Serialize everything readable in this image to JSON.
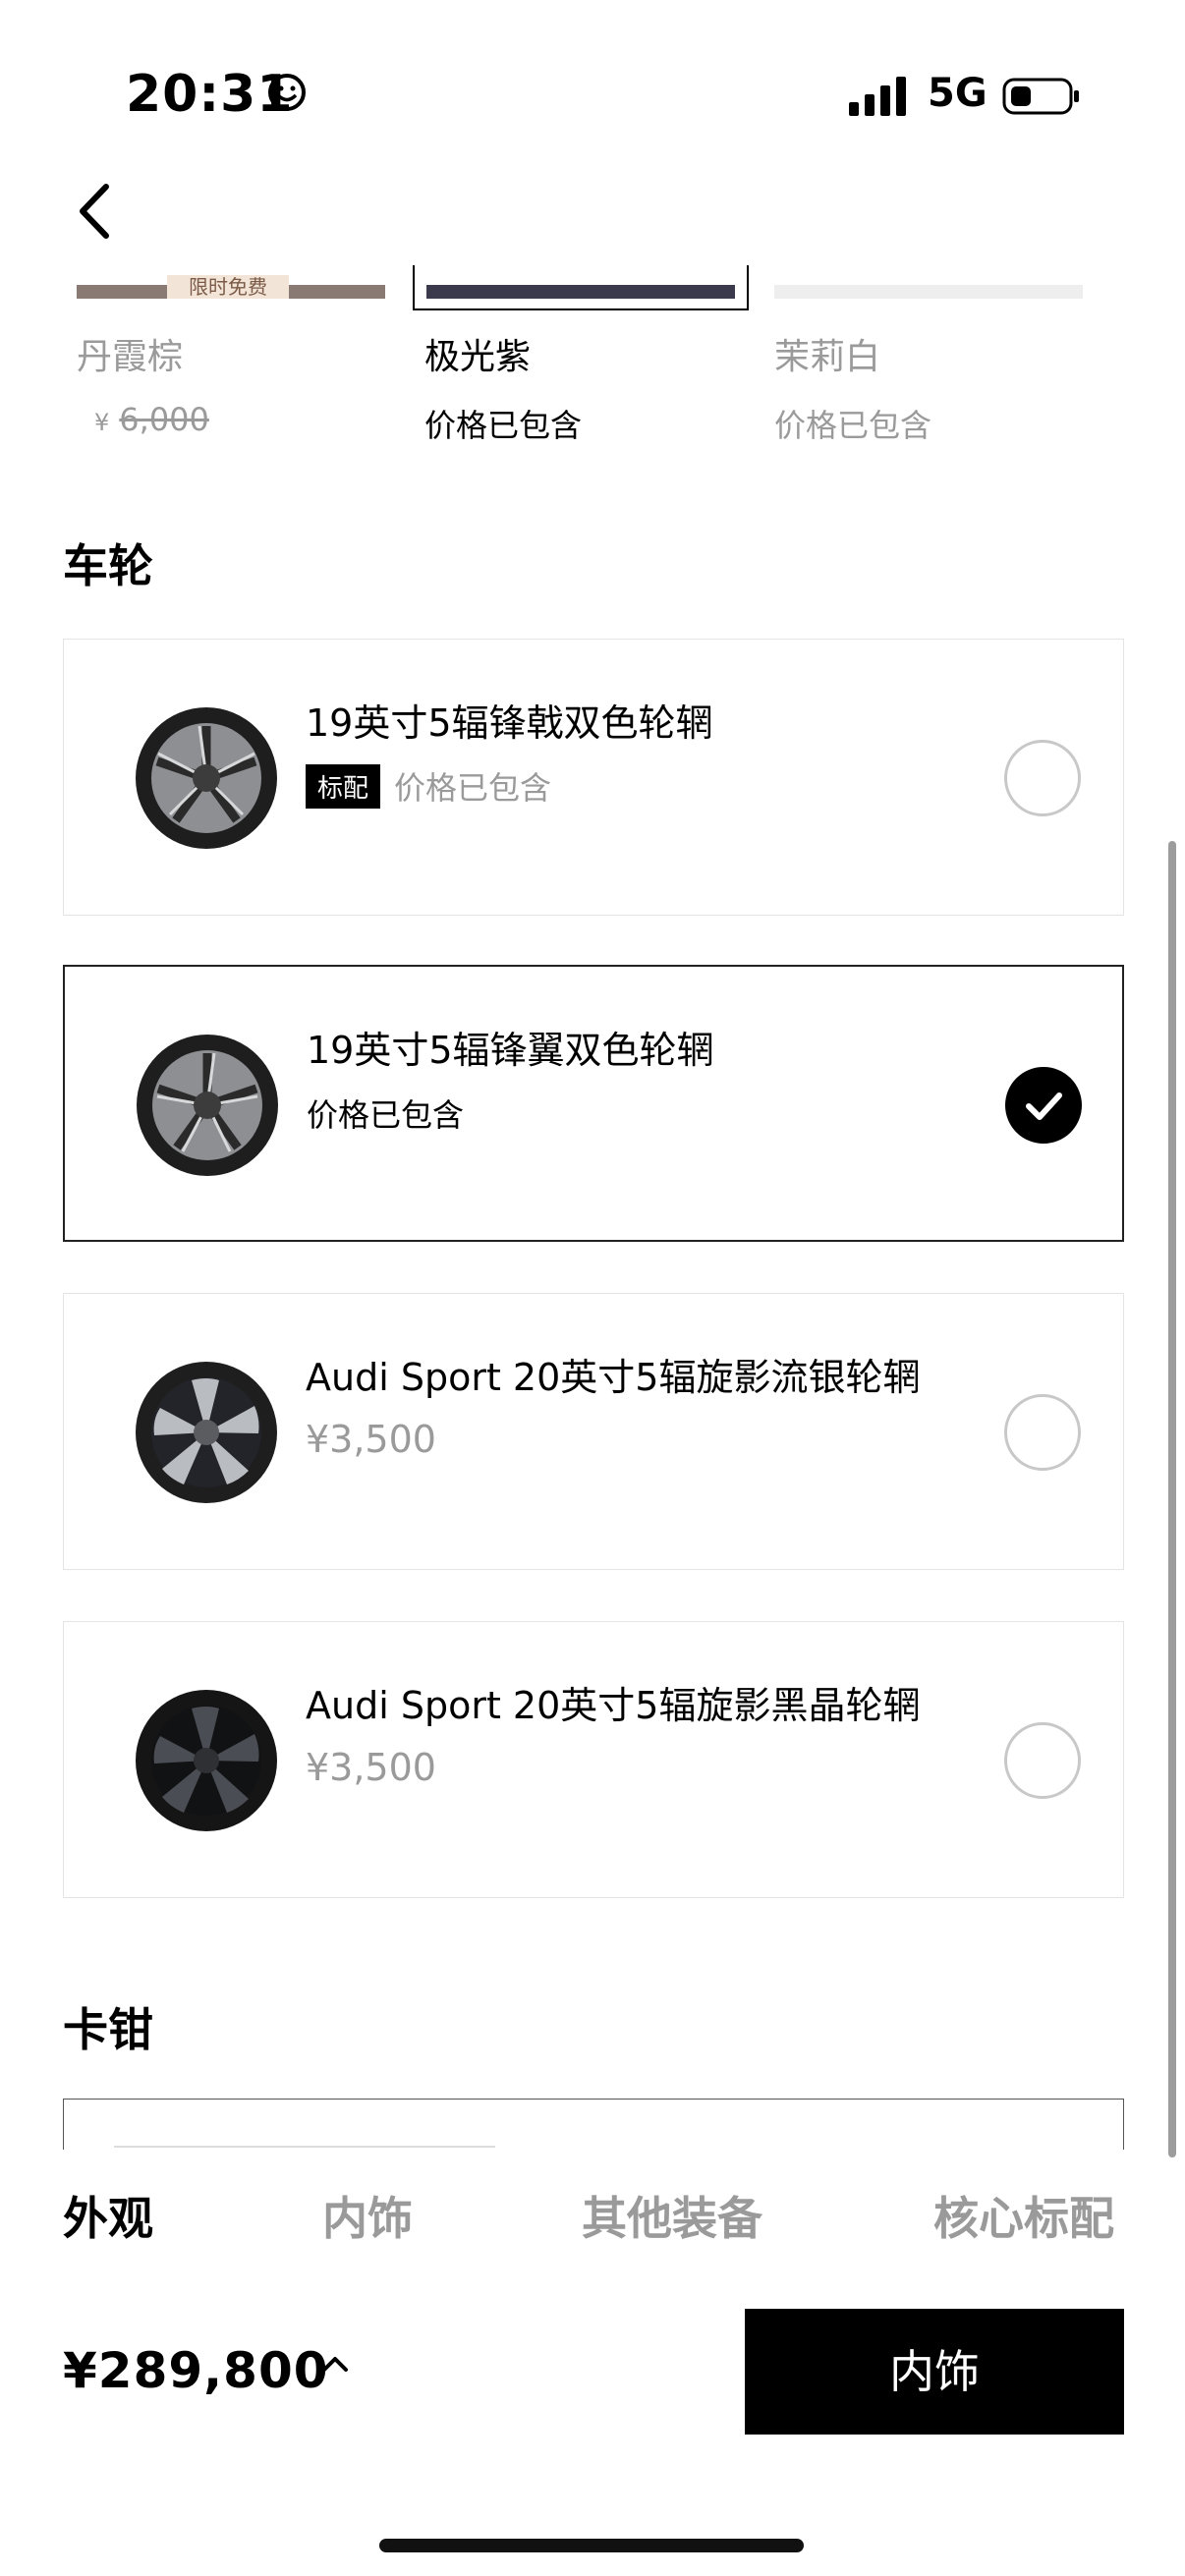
{
  "status_bar": {
    "time": "20:31",
    "network": "5G"
  },
  "colors": [
    {
      "name": "丹霞棕",
      "tag": "限时免费",
      "currency": "¥",
      "price": "6,000",
      "swatch": "#8a7a74"
    },
    {
      "name": "极光紫",
      "price_text": "价格已包含",
      "swatch": "#3a3a4c"
    },
    {
      "name": "茉莉白",
      "price_text": "价格已包含",
      "swatch": "#eeeeee"
    }
  ],
  "wheels_section": {
    "title": "车轮",
    "items": [
      {
        "title": "19英寸5辐锋戟双色轮辋",
        "badge": "标配",
        "price_text": "价格已包含",
        "selected": false
      },
      {
        "title": "19英寸5辐锋翼双色轮辋",
        "price_text": "价格已包含",
        "selected": true
      },
      {
        "title": "Audi Sport 20英寸5辐旋影流银轮辋",
        "price": "¥3,500",
        "selected": false
      },
      {
        "title": "Audi Sport 20英寸5辐旋影黑晶轮辋",
        "price": "¥3,500",
        "selected": false
      }
    ]
  },
  "caliper_section": {
    "title": "卡钳"
  },
  "bottom_tabs": [
    {
      "label": "外观",
      "active": true
    },
    {
      "label": "内饰",
      "active": false
    },
    {
      "label": "其他装备",
      "active": false
    },
    {
      "label": "核心标配",
      "active": false
    }
  ],
  "footer": {
    "total_price": "¥289,800",
    "next_button": "内饰"
  },
  "accent_color": "#000000"
}
